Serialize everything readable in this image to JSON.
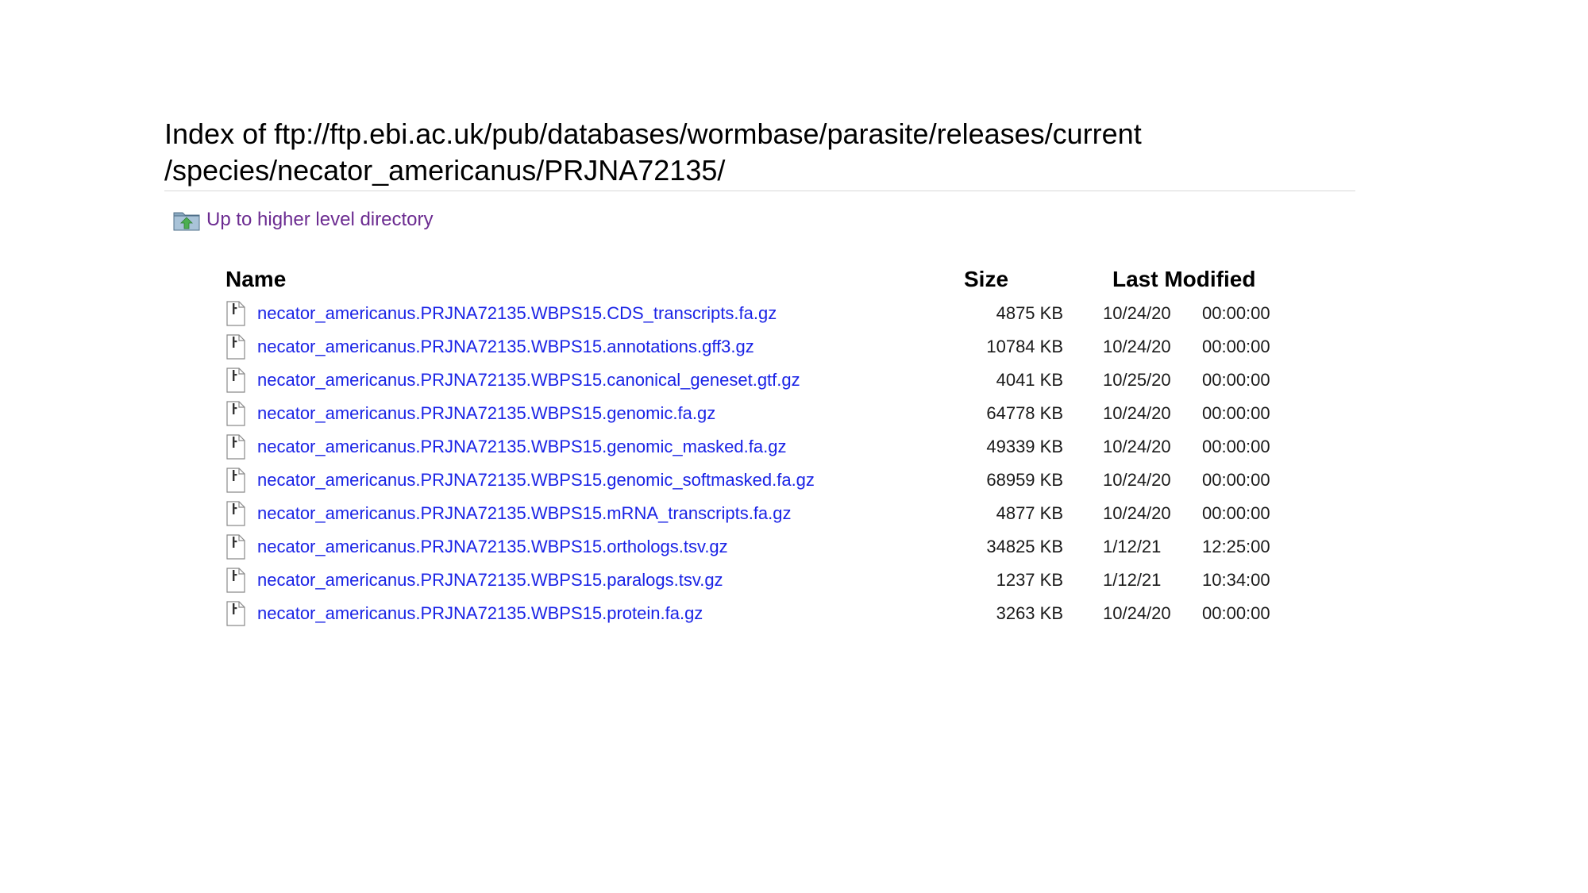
{
  "header": {
    "title_line1": "Index of ftp://ftp.ebi.ac.uk/pub/databases/wormbase/parasite/releases/current",
    "title_line2": "/species/necator_americanus/PRJNA72135/"
  },
  "up_link": {
    "label": "Up to higher level directory",
    "icon": "folder-up-icon"
  },
  "columns": {
    "name": "Name",
    "size": "Size",
    "last_modified": "Last Modified"
  },
  "files": [
    {
      "name": "necator_americanus.PRJNA72135.WBPS15.CDS_transcripts.fa.gz",
      "size": "4875 KB",
      "date": "10/24/20",
      "time": "00:00:00"
    },
    {
      "name": "necator_americanus.PRJNA72135.WBPS15.annotations.gff3.gz",
      "size": "10784 KB",
      "date": "10/24/20",
      "time": "00:00:00"
    },
    {
      "name": "necator_americanus.PRJNA72135.WBPS15.canonical_geneset.gtf.gz",
      "size": "4041 KB",
      "date": "10/25/20",
      "time": "00:00:00"
    },
    {
      "name": "necator_americanus.PRJNA72135.WBPS15.genomic.fa.gz",
      "size": "64778 KB",
      "date": "10/24/20",
      "time": "00:00:00"
    },
    {
      "name": "necator_americanus.PRJNA72135.WBPS15.genomic_masked.fa.gz",
      "size": "49339 KB",
      "date": "10/24/20",
      "time": "00:00:00"
    },
    {
      "name": "necator_americanus.PRJNA72135.WBPS15.genomic_softmasked.fa.gz",
      "size": "68959 KB",
      "date": "10/24/20",
      "time": "00:00:00"
    },
    {
      "name": "necator_americanus.PRJNA72135.WBPS15.mRNA_transcripts.fa.gz",
      "size": "4877 KB",
      "date": "10/24/20",
      "time": "00:00:00"
    },
    {
      "name": "necator_americanus.PRJNA72135.WBPS15.orthologs.tsv.gz",
      "size": "34825 KB",
      "date": "1/12/21",
      "time": "12:25:00"
    },
    {
      "name": "necator_americanus.PRJNA72135.WBPS15.paralogs.tsv.gz",
      "size": "1237 KB",
      "date": "1/12/21",
      "time": "10:34:00"
    },
    {
      "name": "necator_americanus.PRJNA72135.WBPS15.protein.fa.gz",
      "size": "3263 KB",
      "date": "10/24/20",
      "time": "00:00:00"
    }
  ],
  "colors": {
    "link": "#1a23e6",
    "visited_link": "#6c2c91",
    "divider": "#d8d8d8"
  }
}
